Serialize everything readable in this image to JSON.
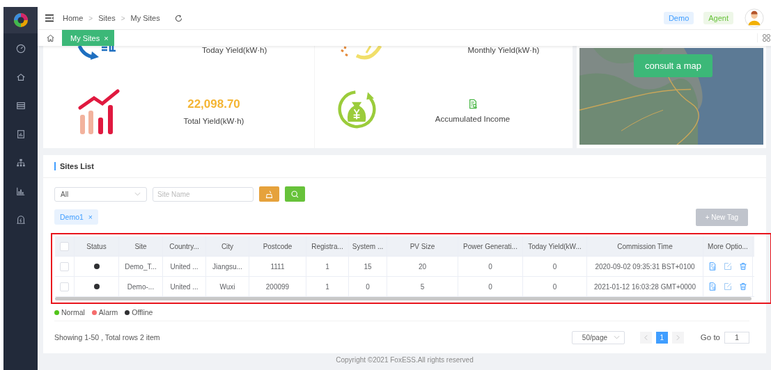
{
  "header": {
    "breadcrumbs": [
      "Home",
      "Sites",
      "My Sites"
    ],
    "separator": ">",
    "tags": [
      {
        "label": "Demo",
        "kind": "info"
      },
      {
        "label": "Agent",
        "kind": "success"
      }
    ]
  },
  "tabs": [
    {
      "label": "My Sites",
      "close": "×",
      "selected": true
    }
  ],
  "stats": {
    "top_row": [
      {
        "label": "Today Yield(kW·h)"
      },
      {
        "label": "Monthly Yield(kW·h)"
      }
    ],
    "bottom_row": [
      {
        "value": "22,098.70",
        "label": "Total Yield(kW·h)"
      },
      {
        "label": "Accumulated Income"
      }
    ]
  },
  "map": {
    "kind": "picture",
    "button": "consult a map"
  },
  "sites_list": {
    "title": "Sites List",
    "filters": {
      "select": "All",
      "placeholder": "Site Name"
    },
    "tag": {
      "label": "Demo1",
      "close": "×"
    },
    "new_tag_button": "+ New Tag",
    "table": {
      "header_checked": false,
      "columns": [
        "Status",
        "Site",
        "Country...",
        "City",
        "Postcode",
        "Registra...",
        "System ...",
        "PV Size",
        "Power Generati...",
        "Today Yield(kW...",
        "Commission Time",
        "More Optio..."
      ],
      "rows": [
        {
          "checked": false,
          "color": "#303133",
          "cells": [
            "",
            "Demo_T...",
            "United ...",
            "Jiangsu...",
            "1111",
            "1",
            "15",
            "20",
            "0",
            "0",
            "2020-09-02 09:35:31 BST+0100"
          ]
        },
        {
          "checked": false,
          "color": "#303133",
          "cells": [
            "",
            "Demo-...",
            "United ...",
            "Wuxi",
            "200099",
            "1",
            "0",
            "5",
            "0",
            "0",
            "2021-01-12 16:03:28 GMT+0000"
          ]
        }
      ]
    },
    "legend": [
      {
        "label": "Normal",
        "color": "#52c41a"
      },
      {
        "label": "Alarm",
        "color": "#f56c6c"
      },
      {
        "label": "Offline",
        "color": "#303133"
      }
    ],
    "summary": "Showing 1-50 , Total rows 2 item",
    "pagination": {
      "page_size": "50/page",
      "pages": [
        {
          "label": "1",
          "selected": true
        }
      ],
      "goto_label": "Go to",
      "goto_value": "1"
    }
  },
  "footer": "Copyright ©2021 FoxESS.All rights reserved"
}
